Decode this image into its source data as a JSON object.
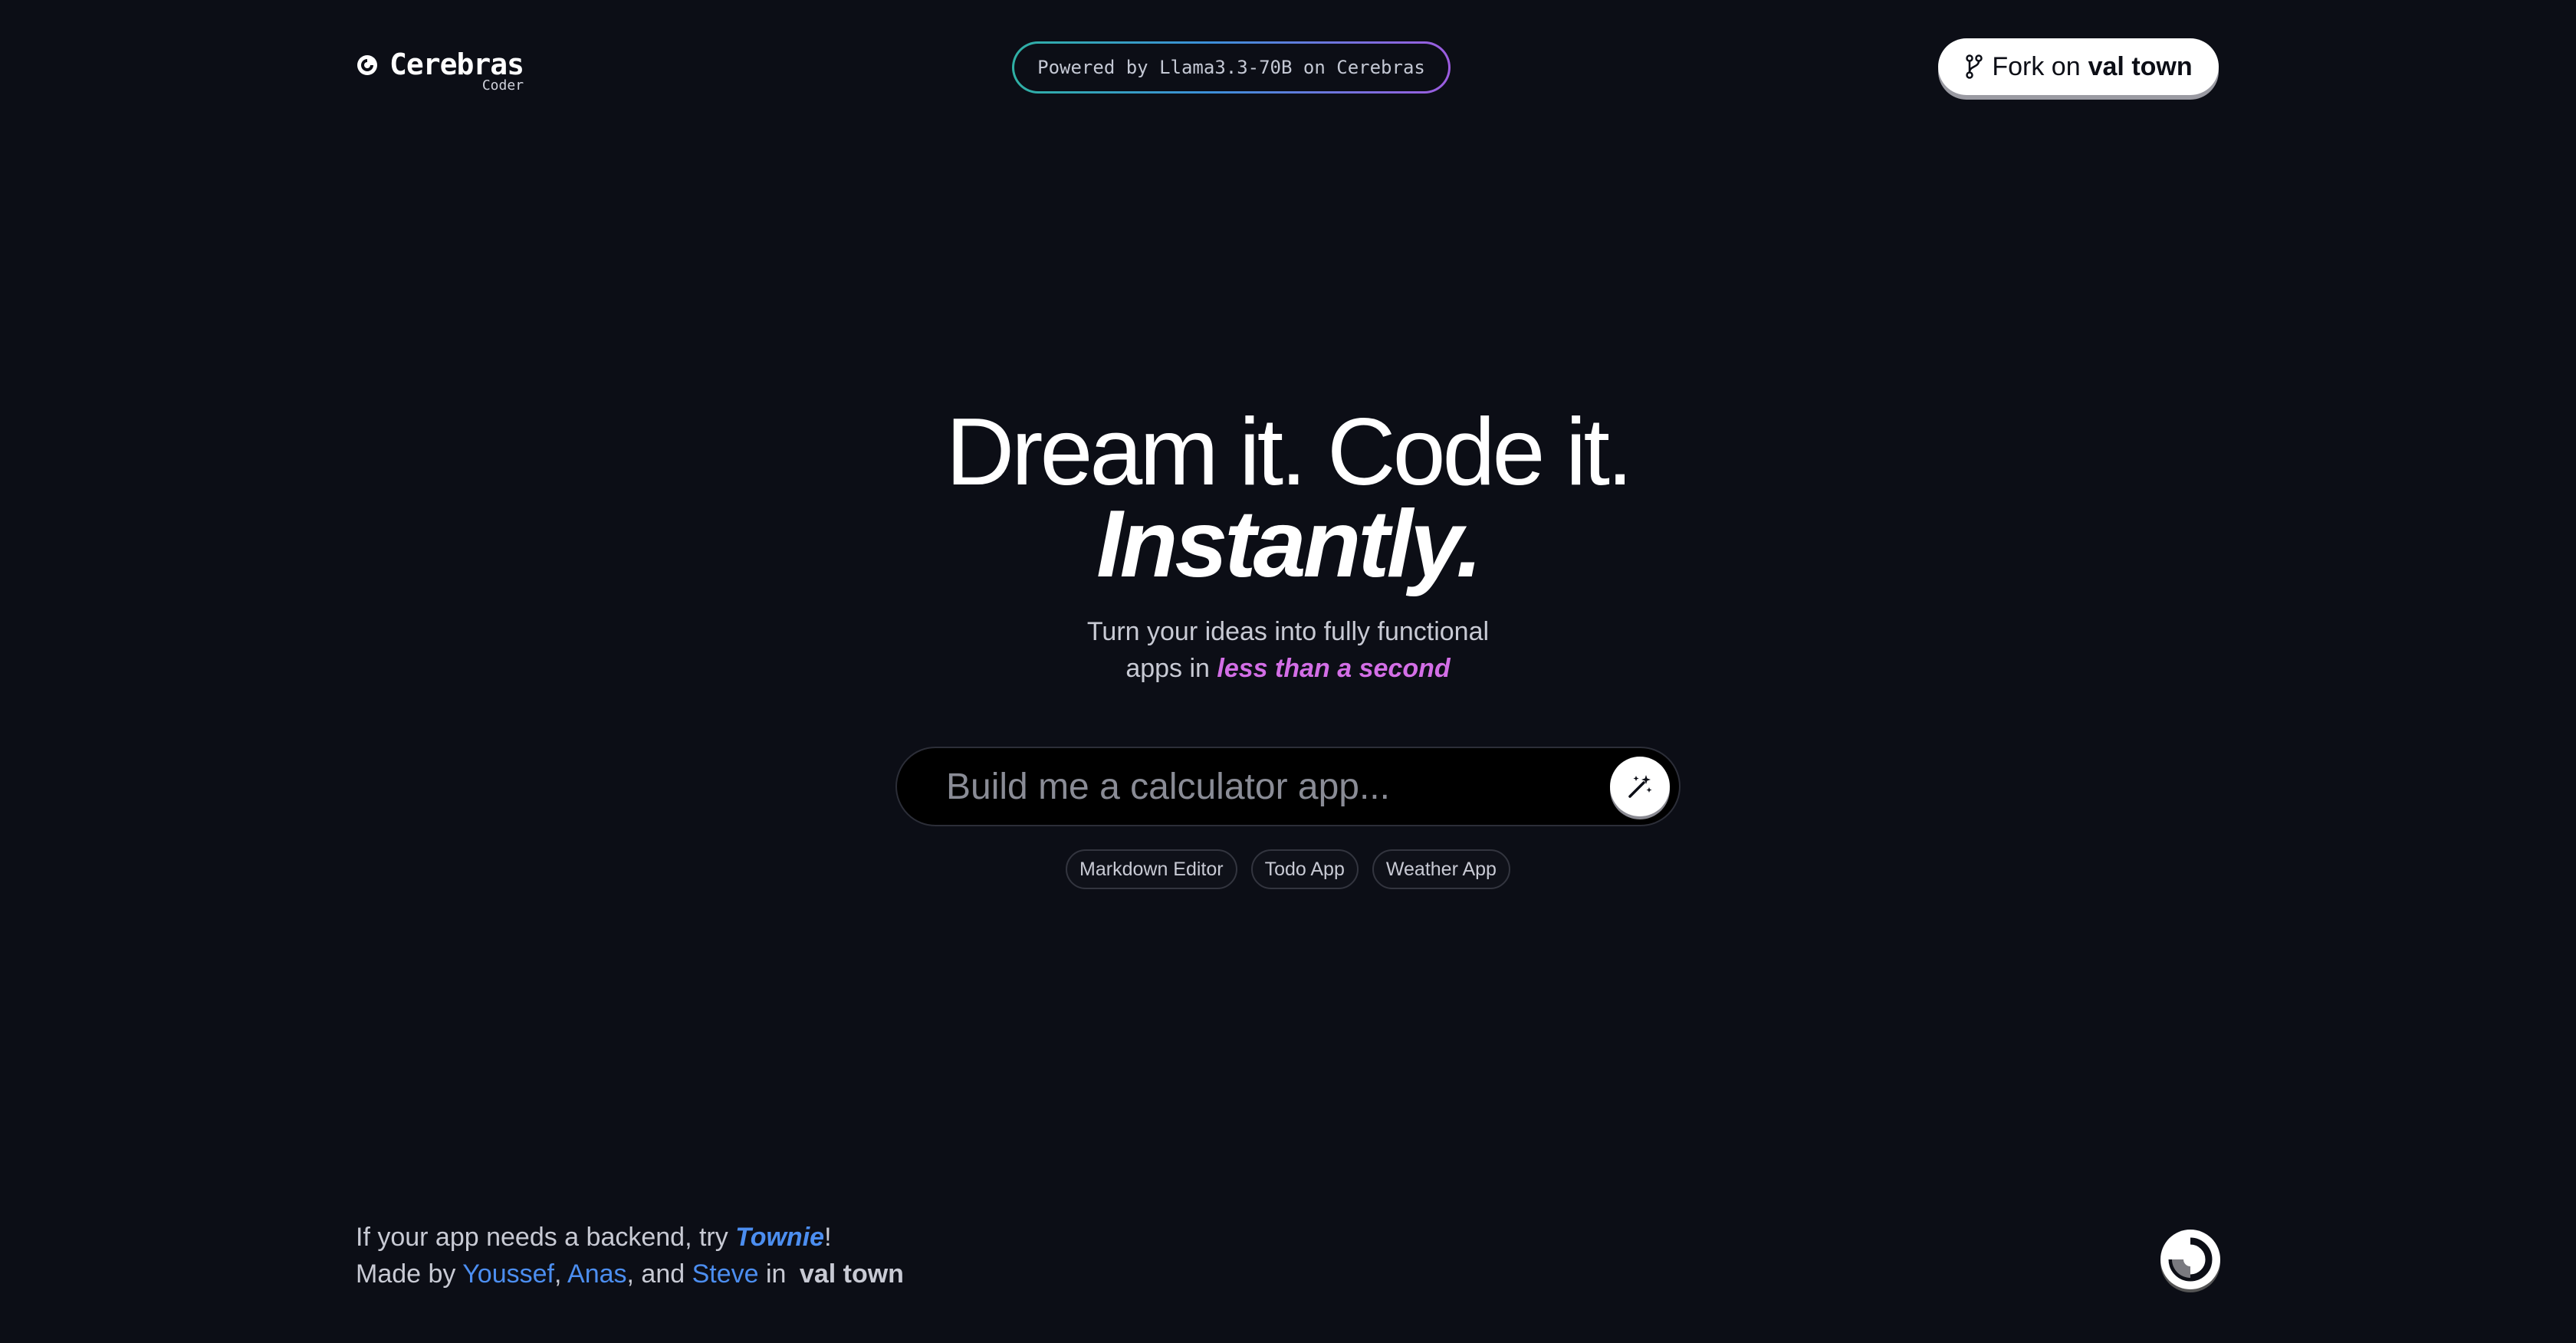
{
  "header": {
    "logo_name": "Cerebras",
    "logo_sub": "Coder",
    "powered_text": "Powered by Llama3.3-70B on Cerebras",
    "fork_prefix": "Fork on",
    "fork_brand": "val town"
  },
  "hero": {
    "line1": "Dream it. Code it.",
    "line2": "Instantly.",
    "subtitle_line1": "Turn your ideas into fully functional",
    "subtitle_line2_prefix": "apps in",
    "subtitle_accent": "less than a second"
  },
  "prompt": {
    "placeholder": "Build me a calculator app..."
  },
  "chips": [
    "Markdown Editor",
    "Todo App",
    "Weather App"
  ],
  "footer": {
    "line1_prefix": "If your app needs a backend, try",
    "townie": "Townie",
    "line1_suffix": "!",
    "made_by": "Made by",
    "author1": "Youssef",
    "sep1": ",",
    "author2": "Anas",
    "sep2": ", and",
    "author3": "Steve",
    "in": "in",
    "brand": "val town"
  },
  "colors": {
    "background": "#0c0e16",
    "accent_purple": "#d36ee6",
    "link_blue": "#4c8ef0"
  },
  "icons": {
    "logo": "cerebras-logo-icon",
    "fork": "git-fork-icon",
    "magic": "magic-wand-icon",
    "corner": "cerebras-logo-icon"
  }
}
